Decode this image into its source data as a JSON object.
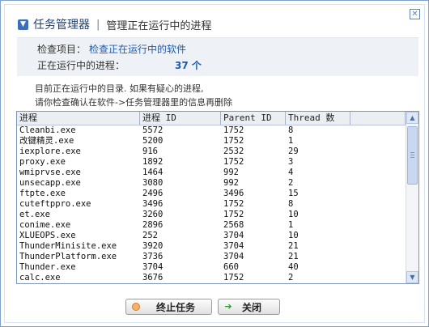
{
  "window": {
    "close_glyph": "✕"
  },
  "header": {
    "icon": "chevron-down-icon",
    "title": "任务管理器",
    "separator": "|",
    "subtitle": "管理正在运行中的进程"
  },
  "info": {
    "item_label": "检查项目：",
    "item_value": "检查正在运行中的软件",
    "running_label": "正在运行中的进程：",
    "running_count": "37 个"
  },
  "note": {
    "line1": "目前正在运行中的目录. 如果有疑心的进程,",
    "line2": "请你检查确认在软件->任务管理器里的信息再删除"
  },
  "table": {
    "columns": [
      "进程",
      "进程 ID",
      "Parent ID",
      "Thread 数"
    ],
    "rows": [
      [
        "Cleanbi.exe",
        "5572",
        "1752",
        "8"
      ],
      [
        "改键精灵.exe",
        "5200",
        "1752",
        "1"
      ],
      [
        "iexplore.exe",
        "916",
        "2532",
        "29"
      ],
      [
        "proxy.exe",
        "1892",
        "1752",
        "3"
      ],
      [
        "wmiprvse.exe",
        "1464",
        "992",
        "4"
      ],
      [
        "unsecapp.exe",
        "3080",
        "992",
        "2"
      ],
      [
        "ftpte.exe",
        "2496",
        "3496",
        "15"
      ],
      [
        "cuteftppro.exe",
        "3496",
        "1752",
        "8"
      ],
      [
        "et.exe",
        "3260",
        "1752",
        "10"
      ],
      [
        "conime.exe",
        "2896",
        "2568",
        "1"
      ],
      [
        "XLUEOPS.exe",
        "252",
        "3704",
        "10"
      ],
      [
        "ThunderMinisite.exe",
        "3920",
        "3704",
        "21"
      ],
      [
        "ThunderPlatform.exe",
        "3736",
        "3704",
        "21"
      ],
      [
        "Thunder.exe",
        "3704",
        "660",
        "40"
      ],
      [
        "calc.exe",
        "3676",
        "1752",
        "2"
      ]
    ],
    "scroll": {
      "up_glyph": "▲",
      "down_glyph": "▼"
    }
  },
  "buttons": {
    "stop_label": "终止任务",
    "close_label": "关闭",
    "close_glyph": "➔"
  },
  "colors": {
    "accent": "#1f5ab0",
    "border": "#7da2ce",
    "info_bg": "#eef1f5"
  }
}
